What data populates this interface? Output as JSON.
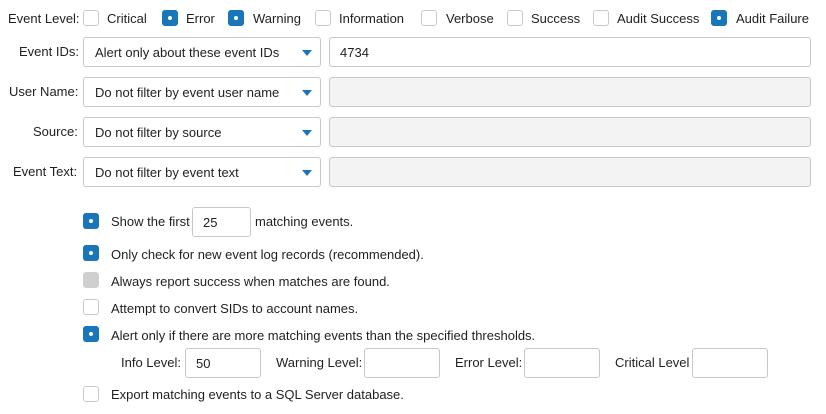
{
  "event_level": {
    "label": "Event Level:",
    "options": [
      {
        "label": "Critical",
        "checked": false
      },
      {
        "label": "Error",
        "checked": true
      },
      {
        "label": "Warning",
        "checked": true
      },
      {
        "label": "Information",
        "checked": false
      },
      {
        "label": "Verbose",
        "checked": false
      },
      {
        "label": "Success",
        "checked": false
      },
      {
        "label": "Audit Success",
        "checked": false
      },
      {
        "label": "Audit Failure",
        "checked": true
      }
    ]
  },
  "filters": [
    {
      "label": "Event IDs:",
      "select": "Alert only about these event IDs",
      "value": "4734",
      "enabled": true
    },
    {
      "label": "User Name:",
      "select": "Do not filter by event user name",
      "value": "",
      "enabled": false
    },
    {
      "label": "Source:",
      "select": "Do not filter by source",
      "value": "",
      "enabled": false
    },
    {
      "label": "Event Text:",
      "select": "Do not filter by event text",
      "value": "",
      "enabled": false
    }
  ],
  "options": {
    "show_first": {
      "checked": true,
      "before": "Show the first",
      "value": "25",
      "after": "matching events."
    },
    "new_records": {
      "checked": true,
      "label": "Only check for new event log records (recommended)."
    },
    "always_success": {
      "checked": false,
      "disabled": true,
      "label": "Always report success when matches are found."
    },
    "convert_sids": {
      "checked": false,
      "label": "Attempt to convert SIDs to account names."
    },
    "thresholds": {
      "checked": true,
      "label": "Alert only if there are more matching events than the specified thresholds."
    },
    "export_sql": {
      "checked": false,
      "label": "Export matching events to a SQL Server database."
    }
  },
  "thresholds": {
    "info": {
      "label": "Info Level:",
      "value": "50"
    },
    "warning": {
      "label": "Warning Level:",
      "value": ""
    },
    "error": {
      "label": "Error Level:",
      "value": ""
    },
    "critical": {
      "label": "Critical Level",
      "value": ""
    }
  },
  "colors": {
    "accent": "#1976b8",
    "disabled": "#cfcfcf",
    "field_disabled": "#f3f3f3"
  }
}
